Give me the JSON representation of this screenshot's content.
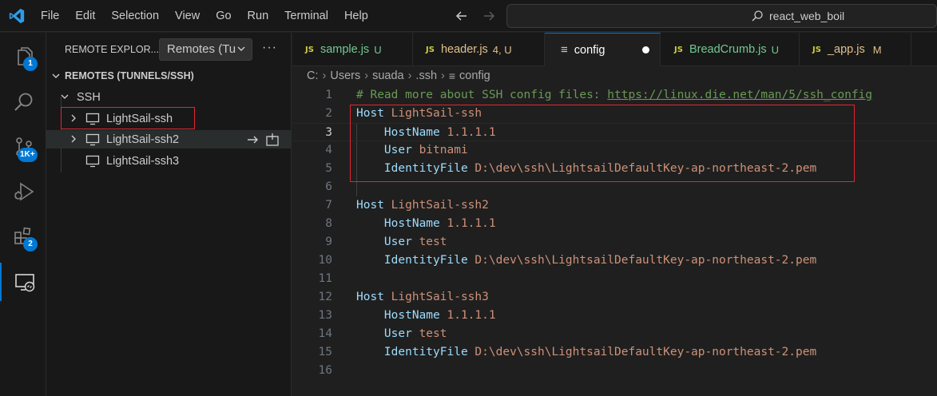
{
  "menu": {
    "items": [
      "File",
      "Edit",
      "Selection",
      "View",
      "Go",
      "Run",
      "Terminal",
      "Help"
    ]
  },
  "search": {
    "text": "react_web_boil"
  },
  "activity": {
    "explorer_badge": "1",
    "scm_badge": "1K+",
    "extensions_badge": "2"
  },
  "sidebar": {
    "title": "REMOTE EXPLOR...",
    "select_value": "Remotes (Tu",
    "more": "···",
    "section_title": "REMOTES (TUNNELS/SSH)",
    "group_label": "SSH",
    "hosts": [
      {
        "label": "LightSail-ssh"
      },
      {
        "label": "LightSail-ssh2"
      },
      {
        "label": "LightSail-ssh3"
      }
    ]
  },
  "tabs": [
    {
      "icon": "JS",
      "name": "sample.js",
      "status": "U",
      "kind": "untracked"
    },
    {
      "icon": "JS",
      "name": "header.js",
      "status": "4, U",
      "kind": "modified"
    },
    {
      "icon": "≡",
      "name": "config",
      "status": "",
      "kind": "active"
    },
    {
      "icon": "JS",
      "name": "BreadCrumb.js",
      "status": "U",
      "kind": "untracked"
    },
    {
      "icon": "JS",
      "name": "_app.js",
      "status": "M",
      "kind": "modified"
    }
  ],
  "breadcrumb": {
    "parts": [
      "C:",
      "Users",
      "suada",
      ".ssh",
      "config"
    ]
  },
  "editor": {
    "lines": [
      {
        "n": "1",
        "comment": "# Read more about SSH config files: ",
        "link": "https://linux.die.net/man/5/ssh_config"
      },
      {
        "n": "2",
        "key": "Host",
        "value": "LightSail-ssh"
      },
      {
        "n": "3",
        "key": "    HostName",
        "value": "1.1.1.1"
      },
      {
        "n": "4",
        "key": "    User",
        "value": "bitnami"
      },
      {
        "n": "5",
        "key": "    IdentityFile",
        "value": "D:\\dev\\ssh\\LightsailDefaultKey-ap-northeast-2.pem"
      },
      {
        "n": "6"
      },
      {
        "n": "7",
        "key": "Host",
        "value": "LightSail-ssh2"
      },
      {
        "n": "8",
        "key": "    HostName",
        "value": "1.1.1.1"
      },
      {
        "n": "9",
        "key": "    User",
        "value": "test"
      },
      {
        "n": "10",
        "key": "    IdentityFile",
        "value": "D:\\dev\\ssh\\LightsailDefaultKey-ap-northeast-2.pem"
      },
      {
        "n": "11"
      },
      {
        "n": "12",
        "key": "Host",
        "value": "LightSail-ssh3"
      },
      {
        "n": "13",
        "key": "    HostName",
        "value": "1.1.1.1"
      },
      {
        "n": "14",
        "key": "    User",
        "value": "test"
      },
      {
        "n": "15",
        "key": "    IdentityFile",
        "value": "D:\\dev\\ssh\\LightsailDefaultKey-ap-northeast-2.pem"
      },
      {
        "n": "16"
      }
    ]
  },
  "colors": {
    "accent": "#0078d4",
    "highlight_box": "#e0262e"
  }
}
